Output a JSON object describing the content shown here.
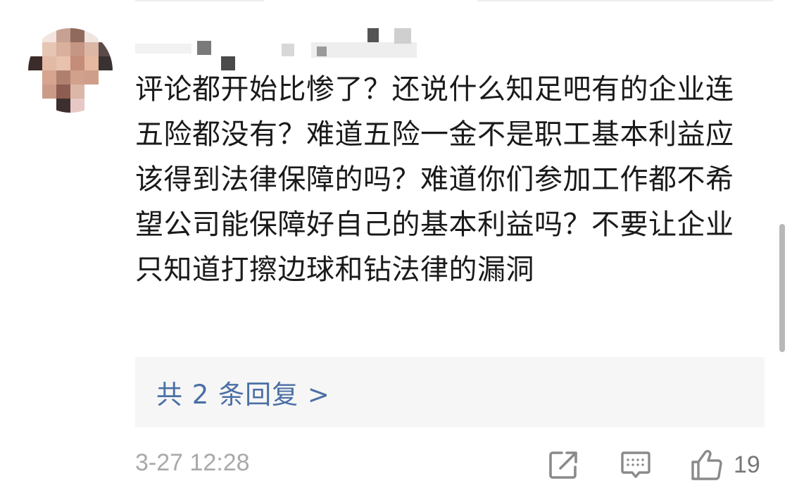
{
  "comment": {
    "text": "评论都开始比惨了？还说什么知足吧有的企业连五险都没有？难道五险一金不是职工基本利益应该得到法律保障的吗？难道你们参加工作都不希望公司能保障好自己的基本利益吗？不要让企业只知道打擦边球和钻法律的漏洞",
    "replies_label": "共 2 条回复 >",
    "timestamp": "3-27 12:28",
    "like_count": "19"
  },
  "icons": {
    "share": "share-icon",
    "comment": "comment-icon",
    "like": "thumbs-up-icon"
  },
  "colors": {
    "link": "#4a6fa5",
    "meta": "#a9a9a9",
    "reply_bg": "#f6f6f6"
  }
}
